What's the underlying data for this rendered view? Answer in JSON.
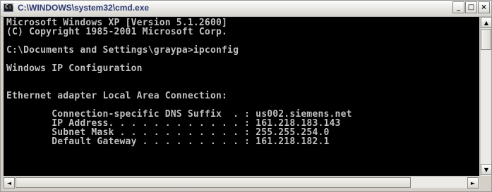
{
  "window": {
    "title": "C:\\WINDOWS\\system32\\cmd.exe",
    "icon_label": "C:\\",
    "controls": {
      "minimize": "_",
      "maximize": "□",
      "close": "×"
    }
  },
  "console": {
    "lines": [
      "Microsoft Windows XP [Version 5.1.2600]",
      "(C) Copyright 1985-2001 Microsoft Corp.",
      "",
      "C:\\Documents and Settings\\graypa>ipconfig",
      "",
      "Windows IP Configuration",
      "",
      "",
      "Ethernet adapter Local Area Connection:",
      "",
      "        Connection-specific DNS Suffix  . : us002.siemens.net",
      "        IP Address. . . . . . . . . . . . : 161.218.183.143",
      "        Subnet Mask . . . . . . . . . . . : 255.255.254.0",
      "        Default Gateway . . . . . . . . . : 161.218.182.1"
    ]
  },
  "scrollbars": {
    "up_arrow": "▲",
    "down_arrow": "▼",
    "left_arrow": "◄",
    "right_arrow": "►"
  }
}
